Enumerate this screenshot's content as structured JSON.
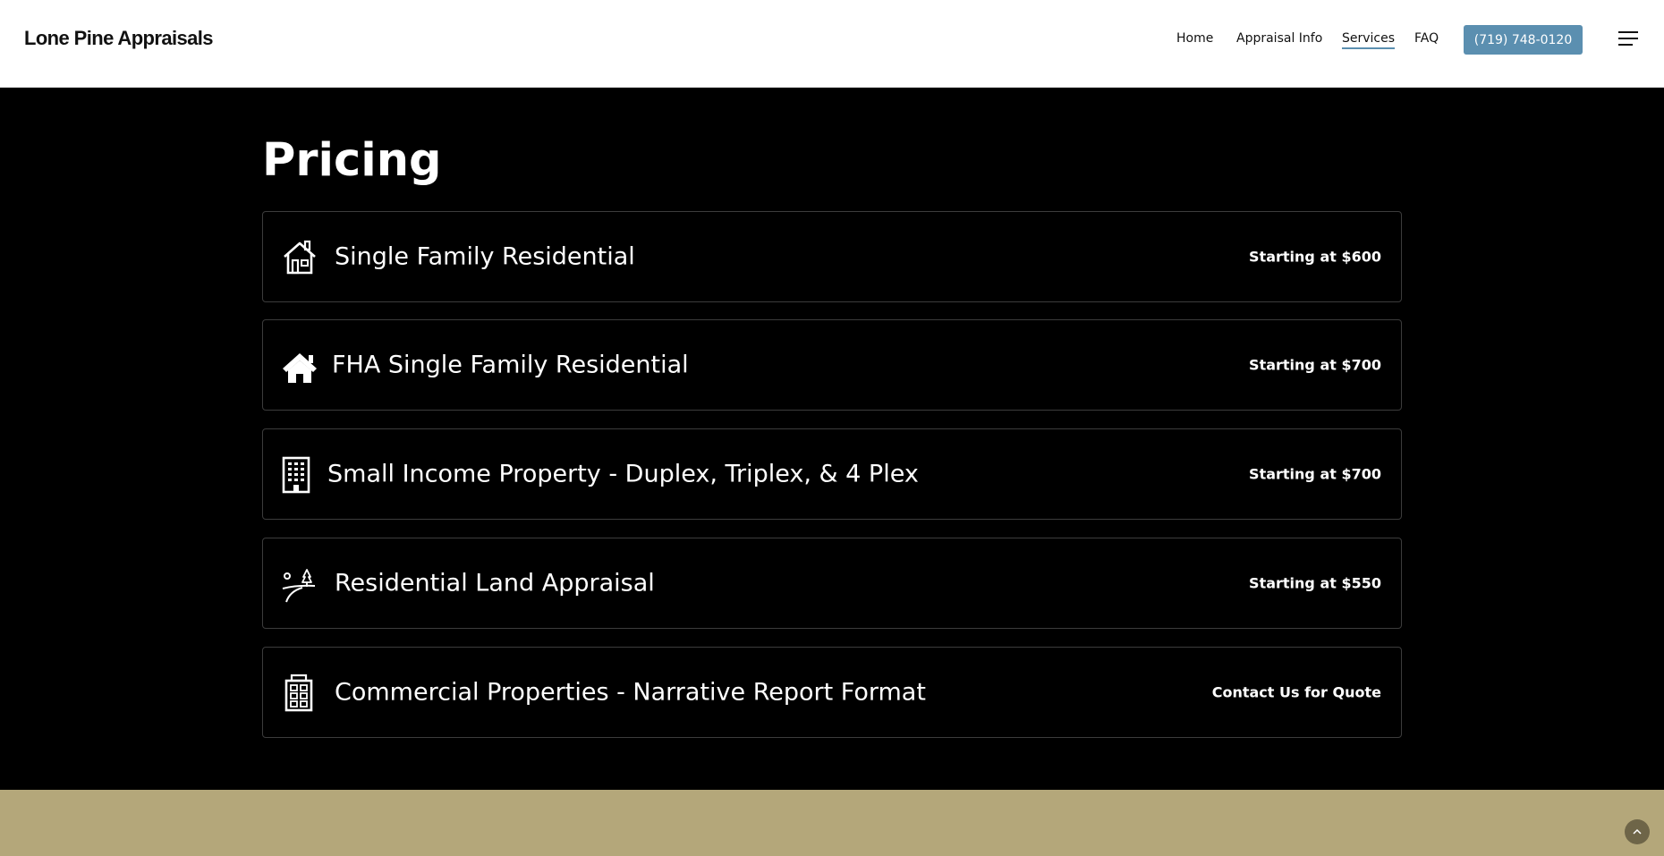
{
  "header": {
    "logo": "Lone Pine Appraisals",
    "nav": [
      {
        "label": "Home",
        "active": false
      },
      {
        "label": "Appraisal Info",
        "active": false
      },
      {
        "label": "Services",
        "active": true
      },
      {
        "label": "FAQ",
        "active": false
      }
    ],
    "phone_label": "(719) 748-0120",
    "menu_icon": "hamburger-icon"
  },
  "main": {
    "title": "Pricing",
    "items": [
      {
        "icon": "house-icon",
        "title": "Single Family Residential",
        "price": "Starting at $600"
      },
      {
        "icon": "house-solid-icon",
        "title": "FHA Single Family Residential",
        "price": "Starting at $700"
      },
      {
        "icon": "building-icon",
        "title": "Small Income Property - Duplex, Triplex, & 4 Plex",
        "price": "Starting at $700"
      },
      {
        "icon": "land-tree-icon",
        "title": "Residential Land Appraisal",
        "price": "Starting at $550"
      },
      {
        "icon": "commercial-building-icon",
        "title": "Commercial Properties - Narrative Report Format",
        "price": "Contact Us for Quote"
      }
    ]
  },
  "footer": {
    "scroll_top_icon": "chevron-up-icon"
  },
  "colors": {
    "accent": "#5b8fb0",
    "band": "#b4a77a",
    "background": "#000000"
  }
}
